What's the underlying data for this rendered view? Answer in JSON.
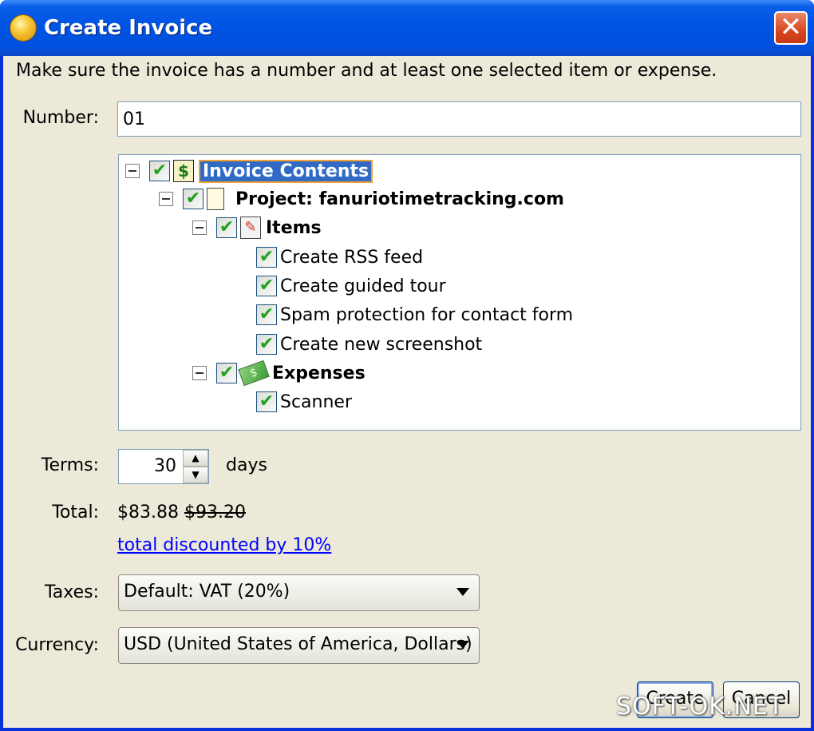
{
  "window": {
    "title": "Create Invoice",
    "close_glyph": "✕"
  },
  "instruction": "Make sure the invoice has a number and at least one selected item or expense.",
  "number": {
    "label": "Number:",
    "value": "01"
  },
  "tree": {
    "root": {
      "label": "Invoice Contents",
      "checked": true,
      "icon": "dollar-document-icon"
    },
    "project": {
      "label": "Project: fanuriotimetracking.com",
      "checked": true,
      "icon": "document-icon"
    },
    "items_group": {
      "label": "Items",
      "checked": true,
      "icon": "clipboard-check-icon",
      "children": [
        {
          "label": "Create RSS feed",
          "checked": true
        },
        {
          "label": "Create guided tour",
          "checked": true
        },
        {
          "label": "Spam protection for contact form",
          "checked": true
        },
        {
          "label": "Create new screenshot",
          "checked": true
        }
      ]
    },
    "expenses_group": {
      "label": "Expenses",
      "checked": true,
      "icon": "money-icon",
      "children": [
        {
          "label": "Scanner",
          "checked": true
        }
      ]
    },
    "check_glyph": "✔"
  },
  "terms": {
    "label": "Terms:",
    "value": "30",
    "unit": "days"
  },
  "total": {
    "label": "Total:",
    "discounted": "$83.88",
    "original": "$93.20",
    "discount_link": "total discounted by 10%"
  },
  "taxes": {
    "label": "Taxes:",
    "selected": "Default: VAT (20%)"
  },
  "currency": {
    "label": "Currency:",
    "selected": "USD (United States of America, Dollars)"
  },
  "buttons": {
    "create": "Create",
    "cancel": "Cancel"
  },
  "watermark": "SOFT-OK.NET"
}
